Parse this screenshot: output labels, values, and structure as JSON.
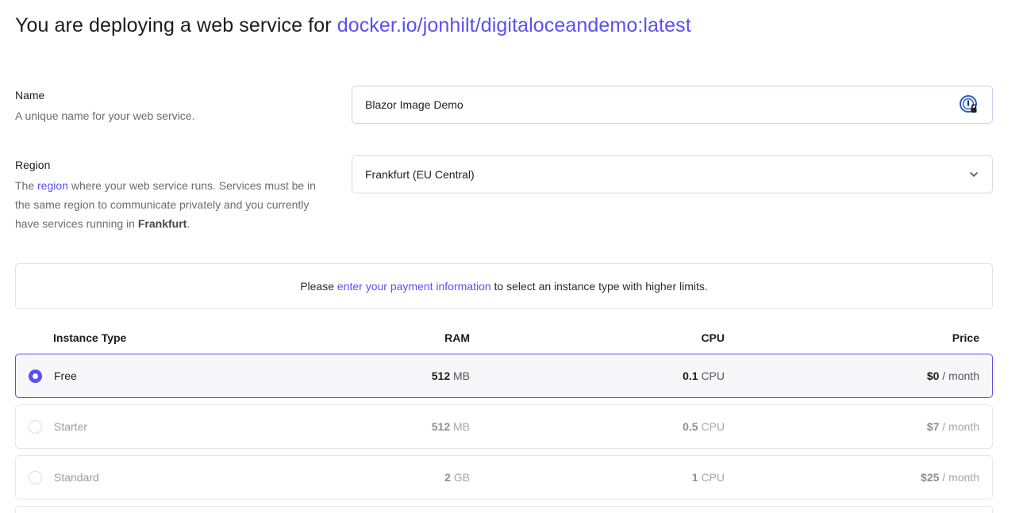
{
  "heading": {
    "prefix": "You are deploying a web service for ",
    "image": "docker.io/jonhilt/digitaloceandemo:latest"
  },
  "name_field": {
    "label": "Name",
    "description": "A unique name for your web service.",
    "value": "Blazor Image Demo",
    "icon": "password-manager-icon"
  },
  "region_field": {
    "label": "Region",
    "desc_before": "The ",
    "desc_link": "region",
    "desc_middle": " where your web service runs. Services must be in the same region to communicate privately and you currently have services running in ",
    "desc_bold": "Frankfurt",
    "desc_end": ".",
    "value": "Frankfurt (EU Central)",
    "icon": "chevron-down-icon"
  },
  "notice": {
    "before": "Please ",
    "link": "enter your payment information",
    "after": " to select an instance type with higher limits."
  },
  "instance_table": {
    "headers": {
      "type": "Instance Type",
      "ram": "RAM",
      "cpu": "CPU",
      "price": "Price"
    },
    "rows": [
      {
        "name": "Free",
        "ram_value": "512",
        "ram_unit": "MB",
        "cpu_value": "0.1",
        "cpu_unit": "CPU",
        "price_value": "$0",
        "price_unit": "/ month",
        "selected": true
      },
      {
        "name": "Starter",
        "ram_value": "512",
        "ram_unit": "MB",
        "cpu_value": "0.5",
        "cpu_unit": "CPU",
        "price_value": "$7",
        "price_unit": "/ month",
        "selected": false
      },
      {
        "name": "Standard",
        "ram_value": "2",
        "ram_unit": "GB",
        "cpu_value": "1",
        "cpu_unit": "CPU",
        "price_value": "$25",
        "price_unit": "/ month",
        "selected": false
      }
    ]
  },
  "colors": {
    "accent": "#5b4ff0",
    "text": "#1c1c20",
    "muted": "#6b6b74",
    "border": "#e6e6eb"
  }
}
